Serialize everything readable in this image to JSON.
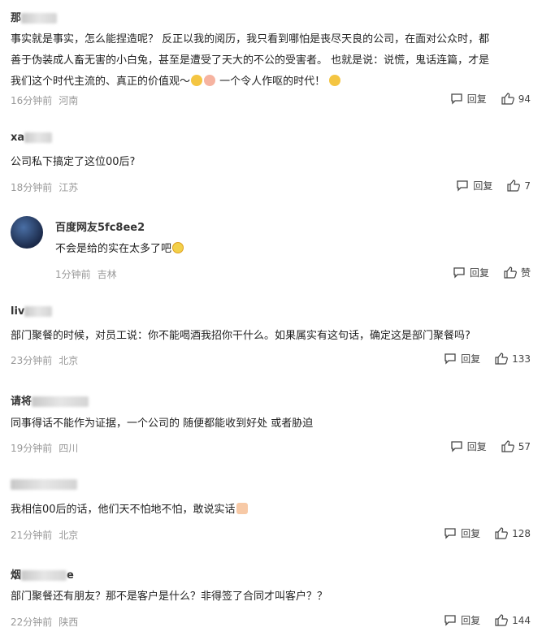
{
  "action_labels": {
    "reply": "回复"
  },
  "comments": [
    {
      "username": "那",
      "text_lines": [
        "事实就是事实，怎么能捏造呢？ 反正以我的阅历，我只看到哪怕是丧尽天良的公司，在面对公众时，都",
        "善于伪装成人畜无害的小白兔，甚至是遭受了天大的不公的受害者。 也就是说：说慌，鬼话连篇，才是",
        "我们这个时代主流的、真正的价值观～",
        "一个令人作呕的时代！"
      ],
      "time": "16分钟前",
      "location": "河南",
      "likes": "94"
    },
    {
      "username": "xa",
      "text_lines": [
        "公司私下搞定了这位00后?"
      ],
      "time": "18分钟前",
      "location": "江苏",
      "likes": "7"
    },
    {
      "username": "百度网友5fc8ee2",
      "text_lines": [
        "不会是给的实在太多了吧"
      ],
      "time": "1分钟前",
      "location": "吉林",
      "likes": "赞"
    },
    {
      "username": "liv",
      "text_lines": [
        "部门聚餐的时候，对员工说：你不能喝酒我招你干什么。如果属实有这句话，确定这是部门聚餐吗?"
      ],
      "time": "23分钟前",
      "location": "北京",
      "likes": "133"
    },
    {
      "username": "请将",
      "text_lines": [
        "同事得话不能作为证据，一个公司的 随便都能收到好处 或者胁迫"
      ],
      "time": "19分钟前",
      "location": "四川",
      "likes": "57"
    },
    {
      "username": "",
      "text_lines": [
        "我相信00后的话，他们天不怕地不怕，敢说实话"
      ],
      "time": "21分钟前",
      "location": "北京",
      "likes": "128"
    },
    {
      "username": "烟",
      "username_tail": "e",
      "text_lines": [
        "部门聚餐还有朋友？那不是客户是什么？非得签了合同才叫客户？？"
      ],
      "time": "22分钟前",
      "location": "陕西",
      "likes": "144"
    }
  ]
}
